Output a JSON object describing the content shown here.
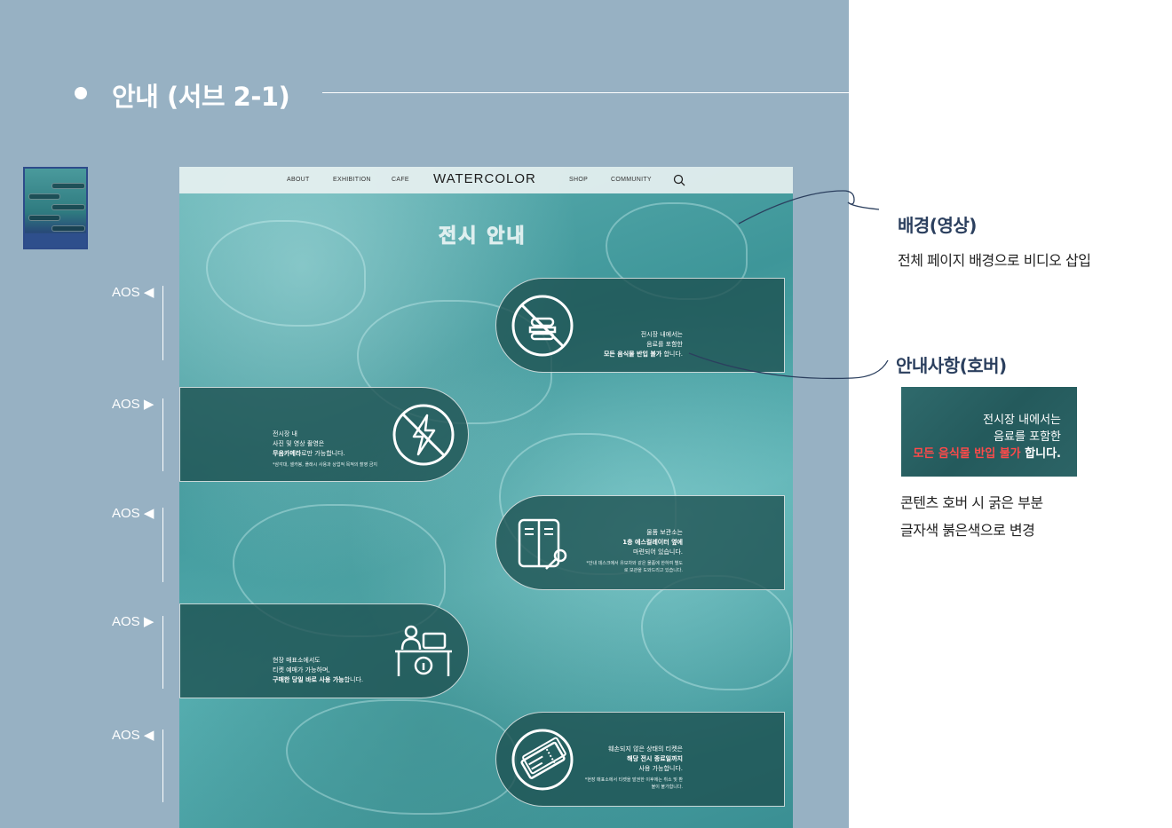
{
  "section": {
    "title": "안내 (서브 2-1)"
  },
  "aos_labels": [
    "AOS ◀",
    "AOS ▶",
    "AOS ◀",
    "AOS ▶",
    "AOS ◀"
  ],
  "mockup": {
    "nav": {
      "about": "ABOUT",
      "exhibition": "EXHIBITION",
      "cafe": "CAFE",
      "logo": "WATERCOLOR",
      "shop": "SHOP",
      "community": "COMMUNITY"
    },
    "heading": "전시 안내",
    "cards": [
      {
        "side": "right",
        "icon": "no-food-icon",
        "line1": "전시장 내에서는",
        "line2": "음료를 포함한",
        "bold": "모든 음식물 반입 불가",
        "tail": " 합니다.",
        "note": ""
      },
      {
        "side": "left",
        "icon": "no-flash-icon",
        "line1": "전시장 내",
        "line2": "사진 및 영상 촬영은",
        "bold": "무음카메라",
        "tail": "로만 가능합니다.",
        "note": "*삼각대, 셀카봉, 플래시 사용과 상업적 목적의 촬영 금지"
      },
      {
        "side": "right",
        "icon": "locker-key-icon",
        "line1": "물품 보관소는",
        "line2": "",
        "bold": "1층 에스컬레이터 옆에",
        "tail": "",
        "line3": "마련되어 있습니다.",
        "note": "*안내 데스크에서 유모차와 같은 물품에 한하여 별도로 보관을 도와드리고 있습니다."
      },
      {
        "side": "left",
        "icon": "ticket-office-icon",
        "line1": "현장 매표소에서도",
        "line2": "티켓 예매가 가능하며,",
        "bold": "구매한 당일 바로 사용 가능",
        "tail": "합니다.",
        "note": ""
      },
      {
        "side": "right",
        "icon": "ticket-icon",
        "line1": "훼손되지 않은 상태의 티켓은",
        "line2": "",
        "bold": "해당 전시 종료일까지",
        "tail": "",
        "line3": "사용 가능합니다.",
        "note": "*현장 매표소에서 티켓을 발권한 이후에는 취소 및 환불이 불가합니다."
      }
    ]
  },
  "annotations": {
    "background": {
      "title": "배경(영상)",
      "desc": "전체 페이지 배경으로 비디오 삽입"
    },
    "hover": {
      "title": "안내사항(호버)",
      "preview_line1": "전시장 내에서는",
      "preview_line2": "음료를 포함한",
      "preview_red": "모든 음식물 반입 불가",
      "preview_tail": " 합니다.",
      "desc1": "콘텐츠 호버 시 굵은 부분",
      "desc2": "글자색 붉은색으로 변경"
    }
  },
  "colors": {
    "panel": "#97b1c3",
    "accent_red": "#ff4a4a",
    "annotation_title": "#2b3f5e"
  }
}
